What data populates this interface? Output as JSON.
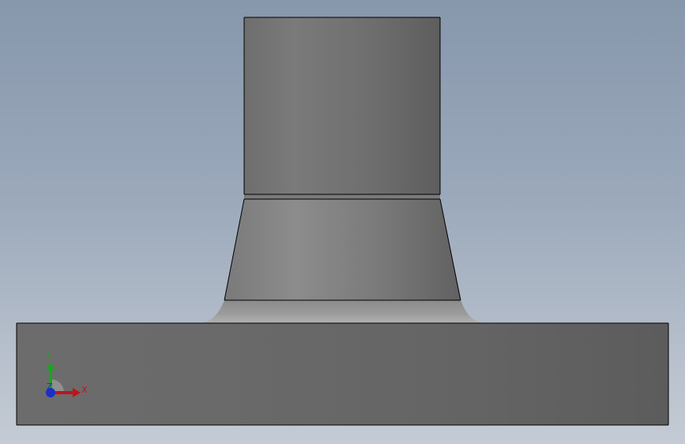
{
  "viewport": {
    "background_top": "#8797ac",
    "background_bottom": "#c4cbd4"
  },
  "model": {
    "parts": [
      "cylinder-top",
      "neck-seam-ring",
      "tapered-neck",
      "fillet-blend",
      "base-block"
    ],
    "body_color": "#6f6f6f",
    "edge_color": "#000000"
  },
  "triad": {
    "x_label": "X",
    "y_label": "Y",
    "z_label": "Z",
    "x_color": "#c0141a",
    "y_color": "#16a81c",
    "z_color": "#1b2fc4"
  }
}
